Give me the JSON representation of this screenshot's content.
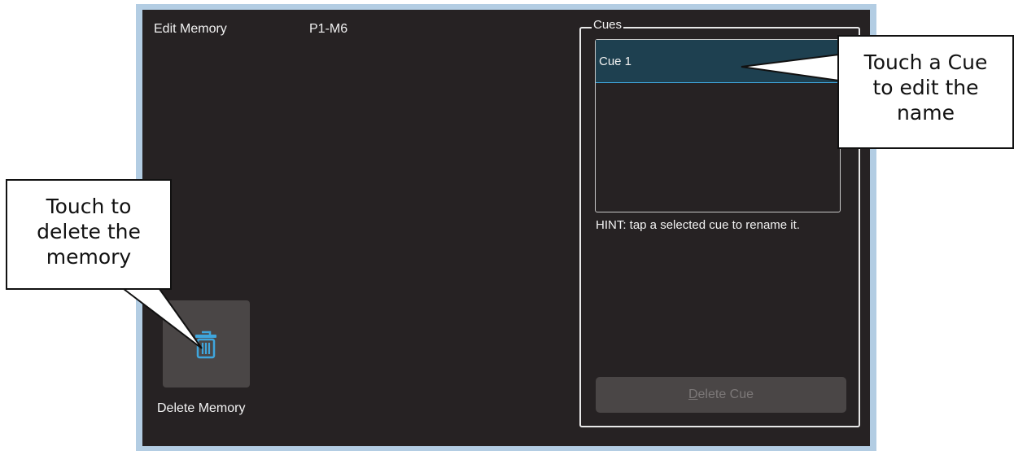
{
  "header": {
    "title": "Edit Memory",
    "memory_id": "P1-M6"
  },
  "cues": {
    "group_label": "Cues",
    "items": [
      {
        "label": "Cue 1",
        "selected": true
      }
    ],
    "hint": "HINT: tap a selected cue to rename it.",
    "delete_cue_label": "Delete Cue"
  },
  "delete_memory": {
    "label": "Delete Memory",
    "icon": "trash-icon"
  },
  "callouts": {
    "right": [
      "Touch a Cue",
      "to edit the",
      "name"
    ],
    "left": [
      "Touch to",
      "delete the",
      "memory"
    ]
  },
  "colors": {
    "panel_bg": "#262223",
    "frame": "#b3cde3",
    "selected_row": "#1e4050",
    "accent": "#3fa6dd",
    "button_bg": "#4a4646"
  }
}
